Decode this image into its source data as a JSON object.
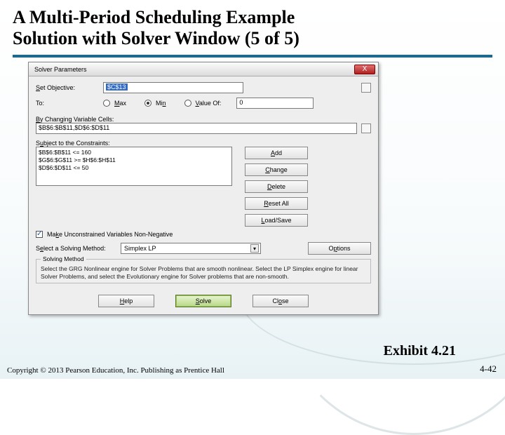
{
  "slide": {
    "title_line1": "A Multi-Period Scheduling Example",
    "title_line2": "Solution with Solver Window (5 of 5)",
    "exhibit": "Exhibit 4.21",
    "copyright": "Copyright © 2013 Pearson Education, Inc. Publishing as Prentice Hall",
    "pagenum": "4-42"
  },
  "dialog": {
    "title": "Solver Parameters",
    "set_objective_label": "Set Objective:",
    "objective_value": "$C$13",
    "to_label": "To:",
    "radios": {
      "max": "Max",
      "min": "Min",
      "valueof": "Value Of:"
    },
    "valueof_value": "0",
    "changing_label": "By Changing Variable Cells:",
    "changing_value": "$B$6:$B$11,$D$6:$D$11",
    "constraints_label": "Subject to the Constraints:",
    "constraints": [
      "$B$6:$B$11 <= 160",
      "$G$6:$G$11 >= $H$6:$H$11",
      "$D$6:$D$11 <= 50"
    ],
    "buttons": {
      "add": "Add",
      "change": "Change",
      "delete": "Delete",
      "reset": "Reset All",
      "loadsave": "Load/Save",
      "options": "Options",
      "help": "Help",
      "solve": "Solve",
      "close": "Close"
    },
    "nonneg_label": "Make Unconstrained Variables Non-Negative",
    "method_label": "Select a Solving Method:",
    "method_value": "Simplex LP",
    "group_title": "Solving Method",
    "group_desc": "Select the GRG Nonlinear engine for Solver Problems that are smooth nonlinear. Select the LP Simplex engine for linear Solver Problems, and select the Evolutionary engine for Solver problems that are non-smooth."
  }
}
